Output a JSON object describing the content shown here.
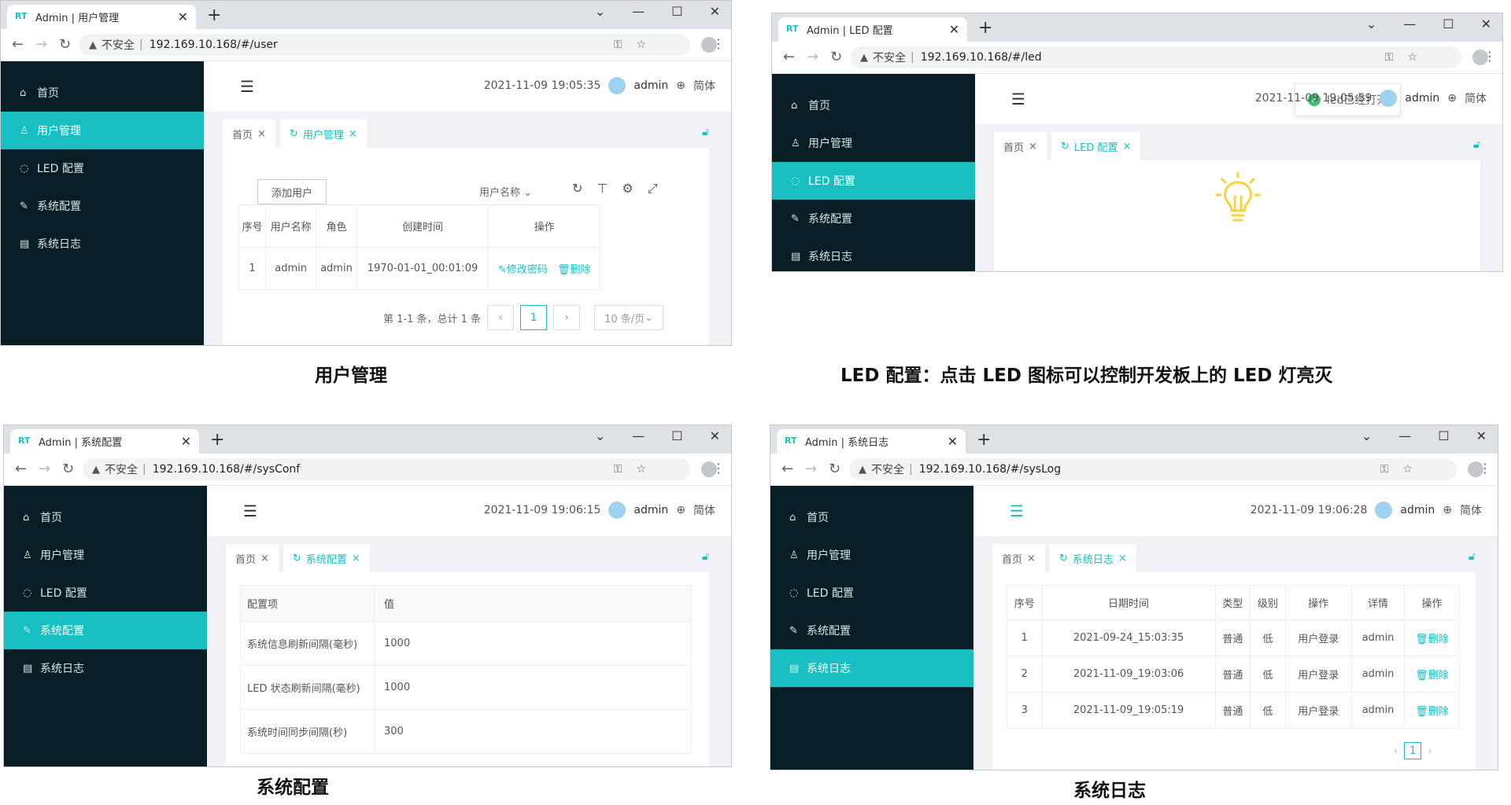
{
  "browser": {
    "insecure_label": "不安全",
    "separator": "|",
    "new_tab": "+",
    "close_tab": "✕",
    "win_min": "⌄",
    "win_restore": "—",
    "win_max": "☐",
    "win_close": "✕"
  },
  "app": {
    "favicon": "RT",
    "datetime_user": "2021-11-09 19:05:35",
    "datetime_led": "2021-11-09 19:05:59",
    "datetime_sys": "2021-11-09 19:06:15",
    "datetime_log": "2021-11-09 19:06:28",
    "username": "admin",
    "lang": "简体",
    "menu": {
      "home": "首页",
      "user": "用户管理",
      "led": "LED 配置",
      "sys": "系统配置",
      "log": "系统日志"
    },
    "tab_home": "首页"
  },
  "user_page": {
    "browser_tab": "Admin | 用户管理",
    "url": "192.169.10.168/#/user",
    "tab": "用户管理",
    "add_user": "添加用户",
    "column_select": "用户名称",
    "headers": [
      "序号",
      "用户名称",
      "角色",
      "创建时间",
      "操作"
    ],
    "row": {
      "index": "1",
      "name": "admin",
      "role": "admin",
      "created": "1970-01-01_00:01:09",
      "edit": "修改密码",
      "delete": "删除"
    },
    "total": "第 1-1 条，总计 1 条",
    "page": "1",
    "page_size": "10 条/页"
  },
  "led_page": {
    "browser_tab": "Admin | LED 配置",
    "url": "192.169.10.168/#/led",
    "tab": "LED 配置",
    "toast": "led已经打开"
  },
  "sys_page": {
    "browser_tab": "Admin | 系统配置",
    "url": "192.169.10.168/#/sysConf",
    "tab": "系统配置",
    "headers": [
      "配置项",
      "值"
    ],
    "rows": [
      {
        "name": "系统信息刷新间隔(毫秒)",
        "value": "1000"
      },
      {
        "name": "LED 状态刷新间隔(毫秒)",
        "value": "1000"
      },
      {
        "name": "系统时间同步间隔(秒)",
        "value": "300"
      }
    ]
  },
  "log_page": {
    "browser_tab": "Admin | 系统日志",
    "url": "192.169.10.168/#/sysLog",
    "tab": "系统日志",
    "headers": [
      "序号",
      "日期时间",
      "类型",
      "级别",
      "操作",
      "详情",
      "操作"
    ],
    "rows": [
      {
        "index": "1",
        "datetime": "2021-09-24_15:03:35",
        "type": "普通",
        "level": "低",
        "action": "用户登录",
        "detail": "admin",
        "delete": "删除"
      },
      {
        "index": "2",
        "datetime": "2021-11-09_19:03:06",
        "type": "普通",
        "level": "低",
        "action": "用户登录",
        "detail": "admin",
        "delete": "删除"
      },
      {
        "index": "3",
        "datetime": "2021-11-09_19:05:19",
        "type": "普通",
        "level": "低",
        "action": "用户登录",
        "detail": "admin",
        "delete": "删除"
      }
    ],
    "page": "1"
  },
  "captions": {
    "user": "用户管理",
    "led": "LED 配置：点击 LED 图标可以控制开发板上的 LED 灯亮灭",
    "sys": "系统配置",
    "log": "系统日志"
  },
  "colors": {
    "accent": "#17bfc3",
    "sidebar": "#071f24",
    "content_bg": "#f0f2f5"
  }
}
